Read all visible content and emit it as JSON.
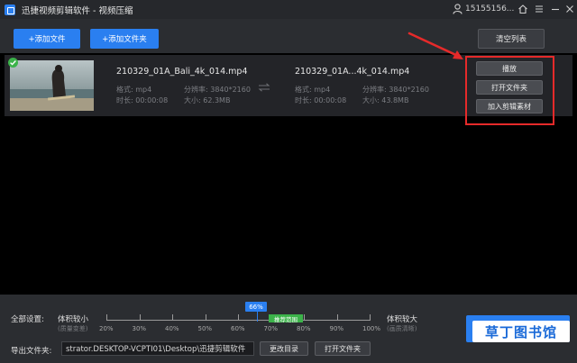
{
  "app": {
    "title": "迅捷视频剪辑软件 - 视频压缩",
    "user": "15155156..."
  },
  "toolbar": {
    "add_file": "+添加文件",
    "add_folder": "+添加文件夹",
    "clear_list": "清空列表"
  },
  "file": {
    "source": {
      "name": "210329_01A_Bali_4k_014.mp4",
      "format": "格式: mp4",
      "resolution": "分辨率: 3840*2160",
      "duration": "时长: 00:00:08",
      "size": "大小: 62.3MB"
    },
    "output": {
      "name": "210329_01A...4k_014.mp4",
      "format": "格式: mp4",
      "resolution": "分辨率: 3840*2160",
      "duration": "时长: 00:00:08",
      "size": "大小: 43.8MB"
    },
    "actions": {
      "play": "播放",
      "open_folder": "打开文件夹",
      "add_to_edit": "加入剪辑素材"
    }
  },
  "settings": {
    "all_settings_label": "全部设置:",
    "small_size": "体积较小",
    "small_size_note": "(质量变差)",
    "large_size": "体积较大",
    "large_size_note": "(画质清晰)",
    "compression_percent": 66,
    "compression_label": "66%",
    "recommended": "推荐范围",
    "ticks": [
      "20%",
      "30%",
      "40%",
      "50%",
      "60%",
      "70%",
      "80%",
      "90%",
      "100%"
    ]
  },
  "output": {
    "label": "导出文件夹:",
    "path": "strator.DESKTOP-VCPTI01\\Desktop\\迅捷剪辑软件",
    "change_dir": "更改目录",
    "open_folder": "打开文件夹"
  },
  "watermark": "草丁图书馆",
  "colors": {
    "accent": "#2a7ff0",
    "success": "#3cb34a",
    "highlight": "#e52a2a"
  }
}
